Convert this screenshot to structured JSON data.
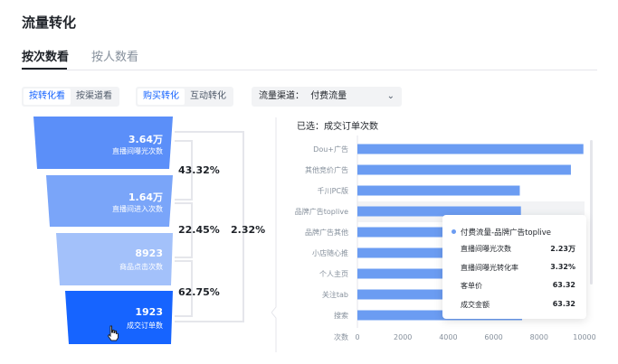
{
  "page_title": "流量转化",
  "tabs": [
    {
      "label": "按次数看",
      "active": true
    },
    {
      "label": "按人数看",
      "active": false
    }
  ],
  "view_toggle": [
    "按转化看",
    "按渠道看"
  ],
  "conversion_toggle": [
    "购买转化",
    "互动转化"
  ],
  "channel_filter": {
    "label": "流量渠道：",
    "value": "付费流量"
  },
  "funnel": {
    "stages": [
      {
        "value": "3.64万",
        "name": "直播间曝光次数",
        "color": "#5b8ff9"
      },
      {
        "value": "1.64万",
        "name": "直播间进入次数",
        "color": "#7aa5f9"
      },
      {
        "value": "8923",
        "name": "商品点击次数",
        "color": "#a3c1fa"
      },
      {
        "value": "1923",
        "name": "成交订单数",
        "color": "#1664ff"
      }
    ],
    "step_rates": [
      "43.32%",
      "22.45%",
      "62.75%"
    ],
    "overall_rate": "2.32%"
  },
  "selected_label": "已选：成交订单次数",
  "chart_data": {
    "type": "bar",
    "orientation": "horizontal",
    "categories": [
      "Dou+广告",
      "其他竞价广告",
      "千川PC版",
      "品牌广告toplive",
      "品牌广告其他",
      "小店随心推",
      "个人主页",
      "关注tab",
      "搜索"
    ],
    "values": [
      9950,
      9400,
      7150,
      7200,
      7050,
      7100,
      7100,
      7200,
      7250
    ],
    "xlabel": "次数",
    "x_ticks": [
      "0",
      "2000",
      "4000",
      "6000",
      "8000",
      "10000"
    ],
    "xlim": [
      0,
      10000
    ],
    "bar_color": "#6b9cf2",
    "highlight_index": 3
  },
  "tooltip": {
    "title": "付费流量-品牌广告toplive",
    "rows": [
      {
        "label": "直播间曝光次数",
        "value": "2.23万"
      },
      {
        "label": "直播间曝光转化率",
        "value": "3.32%"
      },
      {
        "label": "客单价",
        "value": "63.32"
      },
      {
        "label": "成交金额",
        "value": "63.32"
      }
    ]
  }
}
